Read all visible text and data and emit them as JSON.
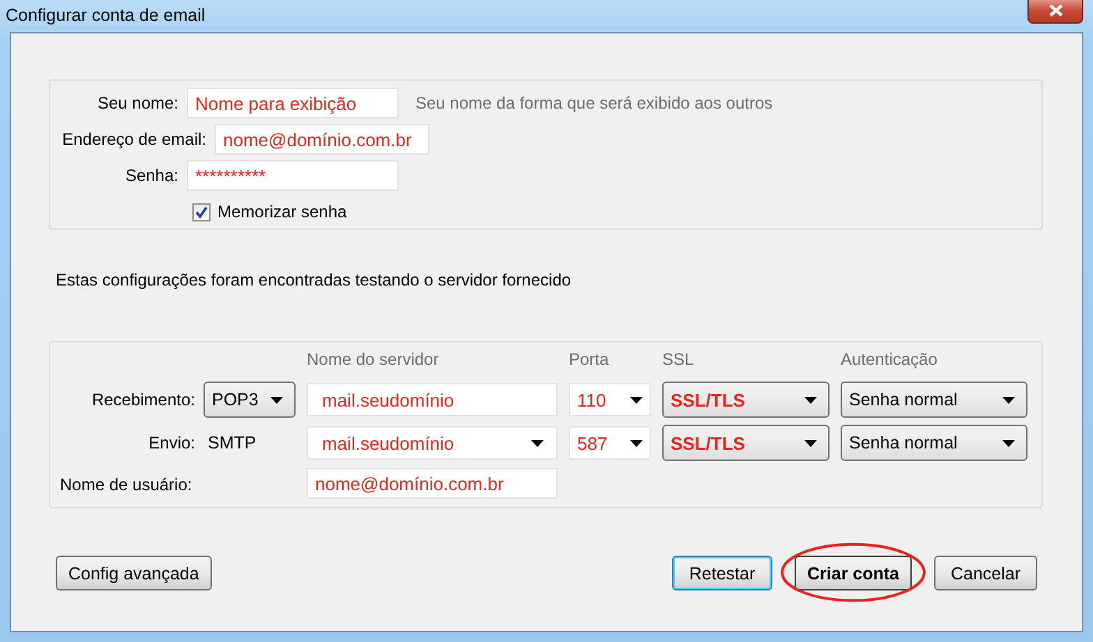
{
  "window": {
    "title": "Configurar conta de email"
  },
  "identity": {
    "fields": [
      {
        "label": "Seu nome:",
        "value": "Nome para exibição",
        "hint": "Seu nome da forma que será exibido aos outros"
      },
      {
        "label": "Endereço de email:",
        "value": "nome@domínio.com.br"
      },
      {
        "label": "Senha:",
        "value": "**********"
      }
    ],
    "remember": {
      "label": "Memorizar senha",
      "checked": true
    }
  },
  "message": "Estas configurações foram encontradas testando o servidor fornecido",
  "servers": {
    "columns": [
      "Nome do servidor",
      "Porta",
      "SSL",
      "Autenticação"
    ],
    "rows": [
      {
        "label": "Recebimento:",
        "type": "POP3",
        "kind": "select",
        "server": "mail.seudomínio",
        "server_dropdown": false,
        "port": "110",
        "ssl": "SSL/TLS",
        "auth": "Senha normal"
      },
      {
        "label": "Envio:",
        "type": "SMTP",
        "kind": "text",
        "server": "mail.seudomínio",
        "server_dropdown": true,
        "port": "587",
        "ssl": "SSL/TLS",
        "auth": "Senha normal"
      }
    ],
    "username": {
      "label": "Nome de usuário:",
      "value": "nome@domínio.com.br"
    }
  },
  "buttons": [
    {
      "label": "Config avançada",
      "kind": "plain",
      "circled": false
    },
    {
      "label": "Retestar",
      "kind": "focused",
      "circled": false
    },
    {
      "label": "Criar conta",
      "kind": "default",
      "circled": true
    },
    {
      "label": "Cancelar",
      "kind": "plain",
      "circled": false
    }
  ]
}
